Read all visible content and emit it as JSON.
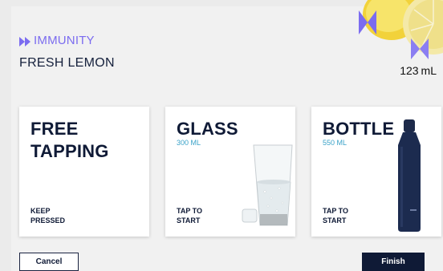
{
  "header": {
    "category": "IMMUNITY",
    "title": "FRESH LEMON"
  },
  "volume": {
    "value": "123",
    "unit": "mL"
  },
  "cards": [
    {
      "title_line1": "FREE",
      "title_line2": "TAPPING",
      "volume": "",
      "action_line1": "KEEP",
      "action_line2": "PRESSED"
    },
    {
      "title_line1": "GLASS",
      "title_line2": "",
      "volume": "300 ML",
      "action_line1": "TAP TO",
      "action_line2": "START"
    },
    {
      "title_line1": "BOTTLE",
      "title_line2": "",
      "volume": "550 ML",
      "action_line1": "TAP TO",
      "action_line2": "START"
    }
  ],
  "buttons": {
    "cancel": "Cancel",
    "finish": "Finish"
  },
  "colors": {
    "accent": "#7b6cf0",
    "navy": "#0f1a36",
    "volume_blue": "#3aa2c8",
    "background": "#ebebeb"
  },
  "icons": {
    "category": "double-play-icon",
    "glass": "glass-of-water-icon",
    "bottle": "water-bottle-icon",
    "lemon": "lemon-image"
  }
}
